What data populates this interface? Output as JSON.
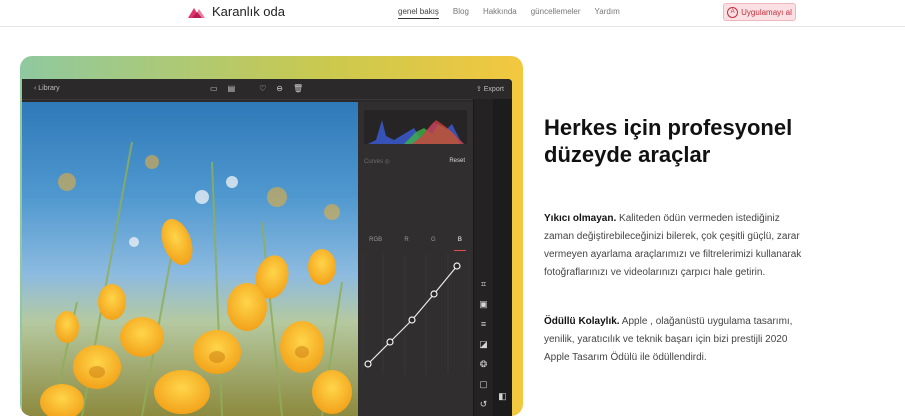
{
  "brand": {
    "name": "Karanlık oda"
  },
  "nav": {
    "items": [
      "genel bakış",
      "Blog",
      "Hakkında",
      "güncellemeler",
      "Yardım"
    ],
    "active_index": 0
  },
  "cta": {
    "label": "Uygulamayı al"
  },
  "app": {
    "back_label": "Library",
    "export_label": "Export",
    "curves_label": "Curves",
    "reset_label": "Reset",
    "channel_tabs": [
      "RGB",
      "R",
      "G",
      "B"
    ],
    "active_channel": "B"
  },
  "hero": {
    "headline": "Herkes için profesyonel düzeyde araçlar",
    "p1_bold": "Yıkıcı olmayan.",
    "p1_text": " Kaliteden ödün vermeden istediğiniz zaman değiştirebileceğinizi bilerek, çok çeşitli güçlü, zarar vermeyen ayarlama araçlarımızı ve filtrelerimizi kullanarak fotoğraflarınızı ve videolarınızı çarpıcı hale getirin.",
    "p2_bold": "Ödüllü Kolaylık.",
    "p2_text": " Apple , olağanüstü uygulama tasarımı, yenilik, yaratıcılık ve teknik başarı için bizi prestijli 2020 Apple Tasarım Ödülü ile ödüllendirdi."
  },
  "colors": {
    "accent": "#c0303d",
    "cta_bg": "#fbe0e3",
    "app_bg": "#2a2828"
  }
}
